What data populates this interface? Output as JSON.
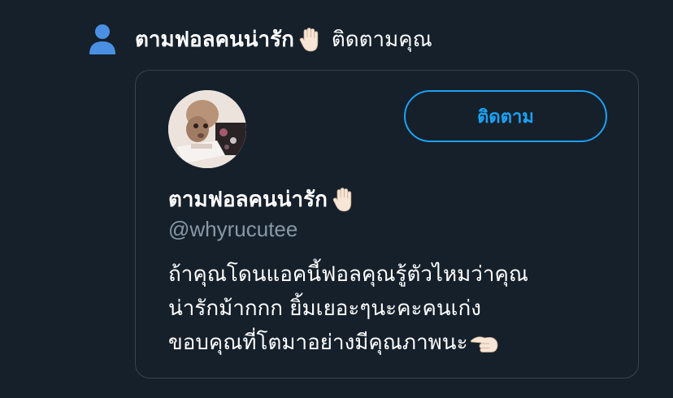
{
  "notification": {
    "icon": "person-icon",
    "name": "ตามฟอลคนน่ารัก",
    "action": "ติดตามคุณ",
    "name_emoji": "raised-hand-emoji"
  },
  "card": {
    "display_name": "ตามฟอลคนน่ารัก",
    "handle": "@whyrucutee",
    "follow_label": "ติดตาม",
    "bio_lines": [
      "ถ้าคุณโดนแอคนี้ฟอลคุณรู้ตัวไหมว่าคุณ",
      "น่ารักม้ากกก ยิ้มเยอะๆนะคะคนเก่ง",
      "ขอบคุณที่โตมาอย่างมีคุณภาพนะ"
    ],
    "bio_end_emoji": "pointing-left-hand-emoji"
  },
  "colors": {
    "background": "#15202b",
    "accent": "#1da1f2",
    "border": "#38444d",
    "muted_text": "#8899a6",
    "icon_blue": "#4a90e2"
  }
}
